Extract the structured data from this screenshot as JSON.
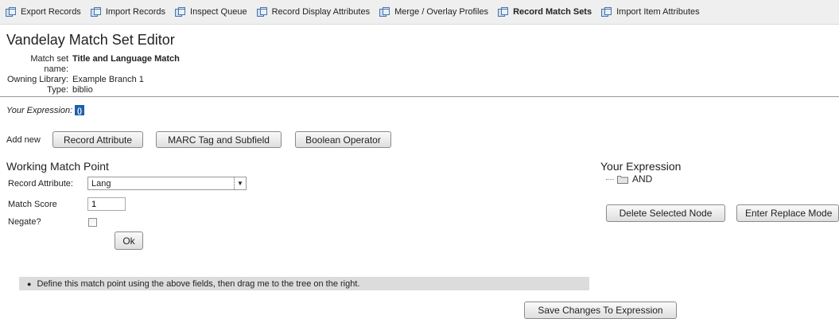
{
  "toolbar": {
    "items": [
      {
        "label": "Export Records",
        "active": false
      },
      {
        "label": "Import Records",
        "active": false
      },
      {
        "label": "Inspect Queue",
        "active": false
      },
      {
        "label": "Record Display Attributes",
        "active": false
      },
      {
        "label": "Merge / Overlay Profiles",
        "active": false
      },
      {
        "label": "Record Match Sets",
        "active": true
      },
      {
        "label": "Import Item Attributes",
        "active": false
      }
    ]
  },
  "page": {
    "title": "Vandelay Match Set Editor"
  },
  "match_set": {
    "name_label": "Match set name:",
    "name_value": "Title and Language Match",
    "owner_label": "Owning Library:",
    "owner_value": "Example Branch 1",
    "type_label": "Type:",
    "type_value": "biblio"
  },
  "expression": {
    "label": "Your Expression:",
    "chip": "()"
  },
  "add_new": {
    "label": "Add new",
    "record_attribute_button": "Record Attribute",
    "marc_tag_button": "MARC Tag and Subfield",
    "boolean_operator_button": "Boolean Operator"
  },
  "working_match_point": {
    "title": "Working Match Point",
    "record_attribute_label": "Record Attribute:",
    "record_attribute_value": "Lang",
    "match_score_label": "Match Score",
    "match_score_value": "1",
    "negate_label": "Negate?",
    "negate_checked": false,
    "ok_button": "Ok"
  },
  "hint": "Define this match point using the above fields, then drag me to the tree on the right.",
  "tree": {
    "title": "Your Expression",
    "root_node": "AND",
    "delete_button": "Delete Selected Node",
    "replace_button": "Enter Replace Mode"
  },
  "save_button": "Save Changes To Expression",
  "colors": {
    "chip": "#1f5fa8",
    "hint_bg": "#dcdcdc",
    "toolbar_bg": "#efefef"
  },
  "icons": {
    "toolbar": "window-icon",
    "tree": "folder-icon",
    "select": "chevron-down-icon"
  }
}
